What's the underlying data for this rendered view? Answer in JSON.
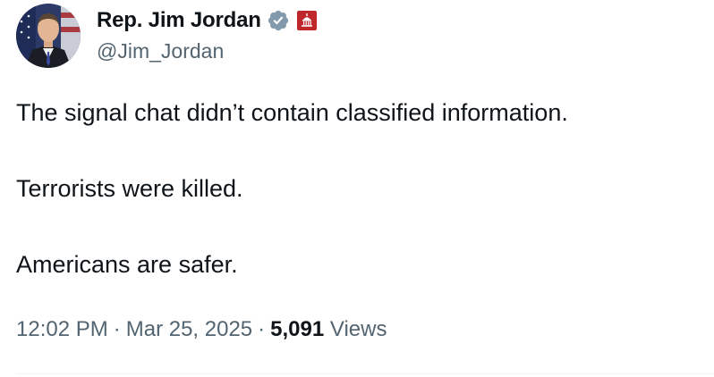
{
  "author": {
    "display_name": "Rep. Jim Jordan",
    "handle": "@Jim_Jordan",
    "verified_badge_color": "#829aab",
    "affiliation_badge_color": "#c0272d"
  },
  "tweet": {
    "paragraphs": [
      "The signal chat didn’t contain classified information.",
      "Terrorists were killed.",
      "Americans are safer."
    ],
    "time": "12:02 PM",
    "date": "Mar 25, 2025",
    "separator": "·",
    "views_count": "5,091",
    "views_label": "Views"
  },
  "icons": {
    "verified": "verified-badge-icon",
    "affiliation": "capitol-affiliation-icon"
  }
}
